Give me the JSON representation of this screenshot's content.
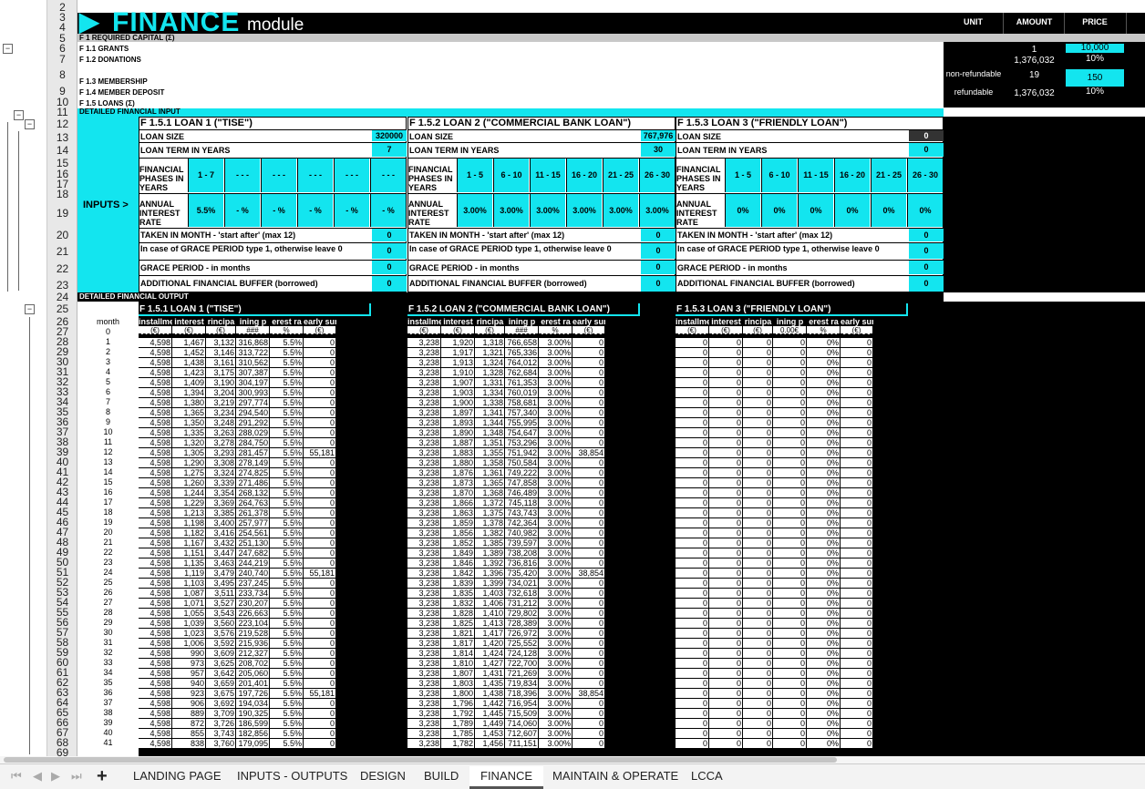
{
  "title": {
    "big": "FINANCE",
    "small": "module"
  },
  "header": {
    "unit": "UNIT",
    "amount": "AMOUNT",
    "price": "PRICE"
  },
  "row_numbers": [
    "2",
    "3",
    "4",
    "5",
    "6",
    "7",
    "8",
    "9",
    "10",
    "11",
    "12",
    "13",
    "14",
    "15",
    "16",
    "17",
    "18",
    "19",
    "20",
    "21",
    "22",
    "23",
    "24",
    "25",
    "26",
    "27",
    "28",
    "29",
    "30",
    "31",
    "32",
    "33",
    "34",
    "35",
    "36",
    "37",
    "38",
    "39",
    "40",
    "41",
    "42",
    "43",
    "44",
    "45",
    "46",
    "47",
    "48",
    "49",
    "50",
    "51",
    "52",
    "53",
    "54",
    "55",
    "56",
    "57",
    "58",
    "59",
    "60",
    "61",
    "62",
    "63",
    "64",
    "65",
    "66",
    "67",
    "68",
    "69"
  ],
  "required": {
    "label": "F 1 REQUIRED CAPITAL (Ʃ)",
    "rows": [
      {
        "label": "F 1.1 GRANTS",
        "unit": "",
        "amount": "1",
        "price": "10,000"
      },
      {
        "label": "F 1.2 DONATIONS",
        "unit": "",
        "amount": "1,376,032",
        "price": "10%"
      },
      {
        "label": "F 1.3 MEMBERSHIP",
        "unit": "non-refundable",
        "amount": "19",
        "price": "150"
      },
      {
        "label": "F 1.4 MEMBER DEPOSIT",
        "unit": "refundable",
        "amount": "1,376,032",
        "price": "10%"
      },
      {
        "label": "F 1.5 LOANS (Ʃ)",
        "unit": "",
        "amount": "",
        "price": ""
      }
    ]
  },
  "detailed_input": "DETAILED FINANCIAL INPUT",
  "detailed_output": "DETAILED FINANCIAL OUTPUT",
  "inputs_label": "INPUTS >",
  "loans": [
    {
      "title": "F 1.5.1 LOAN 1 (\"TISE\")",
      "size_label": "LOAN SIZE",
      "size": "320000",
      "term_label": "LOAN TERM IN YEARS",
      "term": "7",
      "phases_label": "FINANCIAL PHASES IN YEARS",
      "phases": [
        "1 - 7",
        "- - -",
        "- - -",
        "- - -",
        "- - -",
        "- - -"
      ],
      "rate_label": "ANNUAL INTEREST RATE",
      "rates": [
        "5.5%",
        "- %",
        "- %",
        "- %",
        "- %",
        "- %"
      ],
      "taken_label": "TAKEN IN MONTH - 'start after' (max 12)",
      "taken": "0",
      "grace_type_label": "In case of GRACE PERIOD type 1, otherwise leave 0",
      "grace_type": "0",
      "grace_label": "GRACE PERIOD - in months",
      "grace": "0",
      "buffer_label": "ADDITIONAL FINANCIAL BUFFER (borrowed)",
      "buffer": "0"
    },
    {
      "title": "F 1.5.2 LOAN 2 (\"COMMERCIAL BANK LOAN\")",
      "size_label": "LOAN SIZE",
      "size": "767,976",
      "term_label": "LOAN TERM IN YEARS",
      "term": "30",
      "phases_label": "FINANCIAL PHASES IN YEARS",
      "phases": [
        "1 - 5",
        "6 - 10",
        "11 - 15",
        "16 - 20",
        "21 - 25",
        "26 - 30"
      ],
      "rate_label": "ANNUAL INTEREST RATE",
      "rates": [
        "3.00%",
        "3.00%",
        "3.00%",
        "3.00%",
        "3.00%",
        "3.00%"
      ],
      "taken_label": "TAKEN IN MONTH - 'start after' (max 12)",
      "taken": "0",
      "grace_type_label": "In case of GRACE PERIOD type 1, otherwise leave 0",
      "grace_type": "0",
      "grace_label": "GRACE PERIOD - in months",
      "grace": "0",
      "buffer_label": "ADDITIONAL FINANCIAL BUFFER (borrowed)",
      "buffer": "0"
    },
    {
      "title": "F 1.5.3 LOAN 3 (\"FRIENDLY LOAN\")",
      "size_label": "LOAN SIZE",
      "size": "0",
      "term_label": "LOAN TERM IN YEARS",
      "term": "0",
      "phases_label": "FINANCIAL PHASES IN YEARS",
      "phases": [
        "1 - 5",
        "6 - 10",
        "11 - 15",
        "16 - 20",
        "21 - 25",
        "26 - 30"
      ],
      "rate_label": "ANNUAL INTEREST RATE",
      "rates": [
        "0%",
        "0%",
        "0%",
        "0%",
        "0%",
        "0%"
      ],
      "taken_label": "TAKEN IN MONTH - 'start after' (max 12)",
      "taken": "0",
      "grace_type_label": "In case of GRACE PERIOD type 1, otherwise leave 0",
      "grace_type": "0",
      "grace_label": "GRACE PERIOD - in months",
      "grace": "0",
      "buffer_label": "ADDITIONAL FINANCIAL BUFFER (borrowed)",
      "buffer": "0"
    }
  ],
  "output": {
    "month_label": "month",
    "titles": [
      "F 1.5.1 LOAN 1 (\"TISE\")",
      "F 1.5.2 LOAN 2 (\"COMMERCIAL BANK LOAN\")",
      "F 1.5.3 LOAN 3 (\"FRIENDLY LOAN\")"
    ],
    "col_headers": [
      "installmen",
      "interest",
      "rincipa",
      "ining p",
      "erest ra",
      "early sum"
    ],
    "col_units": [
      [
        "(€)",
        "(€)",
        "(€)",
        "###",
        "%",
        "(€)"
      ],
      [
        "(€)",
        "(€)",
        "(€)",
        "###",
        "%",
        "(€)"
      ],
      [
        "(€)",
        "(€)",
        "(€)",
        "0.00€",
        "%",
        "(€)"
      ]
    ],
    "loan1": [
      [
        "4,598",
        "1,467",
        "3,132",
        "316,868",
        "5.5%",
        "0"
      ],
      [
        "4,598",
        "1,452",
        "3,146",
        "313,722",
        "5.5%",
        "0"
      ],
      [
        "4,598",
        "1,438",
        "3,161",
        "310,562",
        "5.5%",
        "0"
      ],
      [
        "4,598",
        "1,423",
        "3,175",
        "307,387",
        "5.5%",
        "0"
      ],
      [
        "4,598",
        "1,409",
        "3,190",
        "304,197",
        "5.5%",
        "0"
      ],
      [
        "4,598",
        "1,394",
        "3,204",
        "300,993",
        "5.5%",
        "0"
      ],
      [
        "4,598",
        "1,380",
        "3,219",
        "297,774",
        "5.5%",
        "0"
      ],
      [
        "4,598",
        "1,365",
        "3,234",
        "294,540",
        "5.5%",
        "0"
      ],
      [
        "4,598",
        "1,350",
        "3,248",
        "291,292",
        "5.5%",
        "0"
      ],
      [
        "4,598",
        "1,335",
        "3,263",
        "288,029",
        "5.5%",
        "0"
      ],
      [
        "4,598",
        "1,320",
        "3,278",
        "284,750",
        "5.5%",
        "0"
      ],
      [
        "4,598",
        "1,305",
        "3,293",
        "281,457",
        "5.5%",
        "55,181"
      ],
      [
        "4,598",
        "1,290",
        "3,308",
        "278,149",
        "5.5%",
        "0"
      ],
      [
        "4,598",
        "1,275",
        "3,324",
        "274,825",
        "5.5%",
        "0"
      ],
      [
        "4,598",
        "1,260",
        "3,339",
        "271,486",
        "5.5%",
        "0"
      ],
      [
        "4,598",
        "1,244",
        "3,354",
        "268,132",
        "5.5%",
        "0"
      ],
      [
        "4,598",
        "1,229",
        "3,369",
        "264,763",
        "5.5%",
        "0"
      ],
      [
        "4,598",
        "1,213",
        "3,385",
        "261,378",
        "5.5%",
        "0"
      ],
      [
        "4,598",
        "1,198",
        "3,400",
        "257,977",
        "5.5%",
        "0"
      ],
      [
        "4,598",
        "1,182",
        "3,416",
        "254,561",
        "5.5%",
        "0"
      ],
      [
        "4,598",
        "1,167",
        "3,432",
        "251,130",
        "5.5%",
        "0"
      ],
      [
        "4,598",
        "1,151",
        "3,447",
        "247,682",
        "5.5%",
        "0"
      ],
      [
        "4,598",
        "1,135",
        "3,463",
        "244,219",
        "5.5%",
        "0"
      ],
      [
        "4,598",
        "1,119",
        "3,479",
        "240,740",
        "5.5%",
        "55,181"
      ],
      [
        "4,598",
        "1,103",
        "3,495",
        "237,245",
        "5.5%",
        "0"
      ],
      [
        "4,598",
        "1,087",
        "3,511",
        "233,734",
        "5.5%",
        "0"
      ],
      [
        "4,598",
        "1,071",
        "3,527",
        "230,207",
        "5.5%",
        "0"
      ],
      [
        "4,598",
        "1,055",
        "3,543",
        "226,663",
        "5.5%",
        "0"
      ],
      [
        "4,598",
        "1,039",
        "3,560",
        "223,104",
        "5.5%",
        "0"
      ],
      [
        "4,598",
        "1,023",
        "3,576",
        "219,528",
        "5.5%",
        "0"
      ],
      [
        "4,598",
        "1,006",
        "3,592",
        "215,936",
        "5.5%",
        "0"
      ],
      [
        "4,598",
        "990",
        "3,609",
        "212,327",
        "5.5%",
        "0"
      ],
      [
        "4,598",
        "973",
        "3,625",
        "208,702",
        "5.5%",
        "0"
      ],
      [
        "4,598",
        "957",
        "3,642",
        "205,060",
        "5.5%",
        "0"
      ],
      [
        "4,598",
        "940",
        "3,659",
        "201,401",
        "5.5%",
        "0"
      ],
      [
        "4,598",
        "923",
        "3,675",
        "197,726",
        "5.5%",
        "55,181"
      ],
      [
        "4,598",
        "906",
        "3,692",
        "194,034",
        "5.5%",
        "0"
      ],
      [
        "4,598",
        "889",
        "3,709",
        "190,325",
        "5.5%",
        "0"
      ],
      [
        "4,598",
        "872",
        "3,726",
        "186,599",
        "5.5%",
        "0"
      ],
      [
        "4,598",
        "855",
        "3,743",
        "182,856",
        "5.5%",
        "0"
      ],
      [
        "4,598",
        "838",
        "3,760",
        "179,095",
        "5.5%",
        "0"
      ]
    ],
    "loan2": [
      [
        "3,238",
        "1,920",
        "1,318",
        "766,658",
        "3.00%",
        "0"
      ],
      [
        "3,238",
        "1,917",
        "1,321",
        "765,336",
        "3.00%",
        "0"
      ],
      [
        "3,238",
        "1,913",
        "1,324",
        "764,012",
        "3.00%",
        "0"
      ],
      [
        "3,238",
        "1,910",
        "1,328",
        "762,684",
        "3.00%",
        "0"
      ],
      [
        "3,238",
        "1,907",
        "1,331",
        "761,353",
        "3.00%",
        "0"
      ],
      [
        "3,238",
        "1,903",
        "1,334",
        "760,019",
        "3.00%",
        "0"
      ],
      [
        "3,238",
        "1,900",
        "1,338",
        "758,681",
        "3.00%",
        "0"
      ],
      [
        "3,238",
        "1,897",
        "1,341",
        "757,340",
        "3.00%",
        "0"
      ],
      [
        "3,238",
        "1,893",
        "1,344",
        "755,995",
        "3.00%",
        "0"
      ],
      [
        "3,238",
        "1,890",
        "1,348",
        "754,647",
        "3.00%",
        "0"
      ],
      [
        "3,238",
        "1,887",
        "1,351",
        "753,296",
        "3.00%",
        "0"
      ],
      [
        "3,238",
        "1,883",
        "1,355",
        "751,942",
        "3.00%",
        "38,854"
      ],
      [
        "3,238",
        "1,880",
        "1,358",
        "750,584",
        "3.00%",
        "0"
      ],
      [
        "3,238",
        "1,876",
        "1,361",
        "749,222",
        "3.00%",
        "0"
      ],
      [
        "3,238",
        "1,873",
        "1,365",
        "747,858",
        "3.00%",
        "0"
      ],
      [
        "3,238",
        "1,870",
        "1,368",
        "746,489",
        "3.00%",
        "0"
      ],
      [
        "3,238",
        "1,866",
        "1,372",
        "745,118",
        "3.00%",
        "0"
      ],
      [
        "3,238",
        "1,863",
        "1,375",
        "743,743",
        "3.00%",
        "0"
      ],
      [
        "3,238",
        "1,859",
        "1,378",
        "742,364",
        "3.00%",
        "0"
      ],
      [
        "3,238",
        "1,856",
        "1,382",
        "740,982",
        "3.00%",
        "0"
      ],
      [
        "3,238",
        "1,852",
        "1,385",
        "739,597",
        "3.00%",
        "0"
      ],
      [
        "3,238",
        "1,849",
        "1,389",
        "738,208",
        "3.00%",
        "0"
      ],
      [
        "3,238",
        "1,846",
        "1,392",
        "736,816",
        "3.00%",
        "0"
      ],
      [
        "3,238",
        "1,842",
        "1,396",
        "735,420",
        "3.00%",
        "38,854"
      ],
      [
        "3,238",
        "1,839",
        "1,399",
        "734,021",
        "3.00%",
        "0"
      ],
      [
        "3,238",
        "1,835",
        "1,403",
        "732,618",
        "3.00%",
        "0"
      ],
      [
        "3,238",
        "1,832",
        "1,406",
        "731,212",
        "3.00%",
        "0"
      ],
      [
        "3,238",
        "1,828",
        "1,410",
        "729,802",
        "3.00%",
        "0"
      ],
      [
        "3,238",
        "1,825",
        "1,413",
        "728,389",
        "3.00%",
        "0"
      ],
      [
        "3,238",
        "1,821",
        "1,417",
        "726,972",
        "3.00%",
        "0"
      ],
      [
        "3,238",
        "1,817",
        "1,420",
        "725,552",
        "3.00%",
        "0"
      ],
      [
        "3,238",
        "1,814",
        "1,424",
        "724,128",
        "3.00%",
        "0"
      ],
      [
        "3,238",
        "1,810",
        "1,427",
        "722,700",
        "3.00%",
        "0"
      ],
      [
        "3,238",
        "1,807",
        "1,431",
        "721,269",
        "3.00%",
        "0"
      ],
      [
        "3,238",
        "1,803",
        "1,435",
        "719,834",
        "3.00%",
        "0"
      ],
      [
        "3,238",
        "1,800",
        "1,438",
        "718,396",
        "3.00%",
        "38,854"
      ],
      [
        "3,238",
        "1,796",
        "1,442",
        "716,954",
        "3.00%",
        "0"
      ],
      [
        "3,238",
        "1,792",
        "1,445",
        "715,509",
        "3.00%",
        "0"
      ],
      [
        "3,238",
        "1,789",
        "1,449",
        "714,060",
        "3.00%",
        "0"
      ],
      [
        "3,238",
        "1,785",
        "1,453",
        "712,607",
        "3.00%",
        "0"
      ],
      [
        "3,238",
        "1,782",
        "1,456",
        "711,151",
        "3.00%",
        "0"
      ]
    ],
    "loan3_row": [
      "0",
      "0",
      "0",
      "0",
      "0%",
      "0"
    ]
  },
  "tabs": [
    "LANDING PAGE",
    "INPUTS - OUTPUTS",
    "DESIGN",
    "BUILD",
    "FINANCE",
    "MAINTAIN & OPERATE",
    "LCCA"
  ],
  "active_tab": "FINANCE",
  "icons": [
    "first-sheet-icon",
    "prev-sheet-icon",
    "next-sheet-icon",
    "last-sheet-icon",
    "add-sheet-icon",
    "collapse-group-icon"
  ],
  "colors": {
    "accent": "#13e5ef",
    "black": "#000000",
    "gray": "#c8c8c8"
  }
}
